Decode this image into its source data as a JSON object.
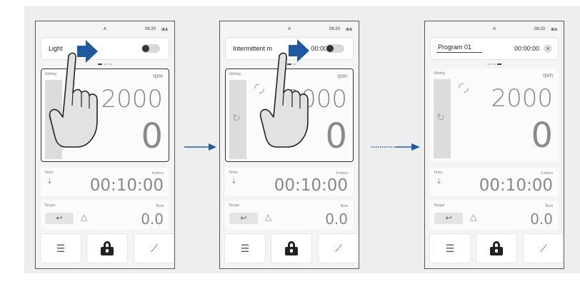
{
  "common": {
    "mode": "A",
    "time": "08:20",
    "brand": "IKA",
    "stirring": {
      "caption": "Stirring",
      "unit": "rpm",
      "setpoint": "2000",
      "actual": "0"
    },
    "timer": {
      "caption": "Timer",
      "unit": "h:min:s",
      "value": "00:10:00"
    },
    "torque": {
      "caption": "Torque",
      "unit": "Ncm",
      "value": "0.0"
    },
    "bottom_icons": [
      "menu-icon",
      "lock-icon",
      "chart-icon"
    ]
  },
  "screens": [
    {
      "top_label": "Light",
      "toggle_state": "off",
      "page_indicator_active": 1
    },
    {
      "top_label": "Intermittent m",
      "top_value": "00:00",
      "toggle_state": "off",
      "page_indicator_active": 2
    },
    {
      "top_label": "Program 01",
      "top_value": "00:00:00",
      "page_indicator_active": 3
    }
  ],
  "colors": {
    "arrow": "#1f5aa0",
    "frame": "#555555",
    "background": "#eeeeee"
  }
}
